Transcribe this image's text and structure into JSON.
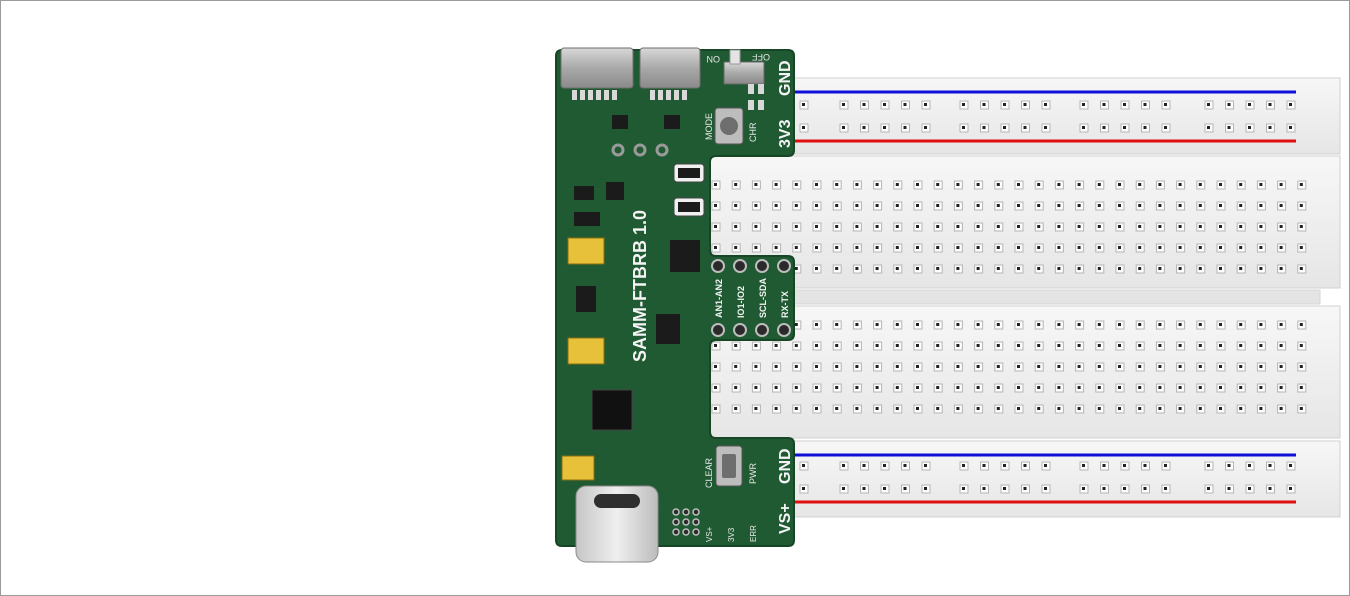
{
  "board": {
    "title": "SAMM-FTBRB 1.0",
    "top_rail_labels": {
      "gnd": "GND",
      "v3v3": "3V3"
    },
    "bottom_rail_labels": {
      "gnd": "GND",
      "vs": "VS+"
    },
    "switch_labels": {
      "on": "ON",
      "off": "OFF"
    },
    "button_labels": {
      "mode": "MODE",
      "chr": "CHR",
      "clear": "CLEAR",
      "pwr": "PWR"
    },
    "pin_labels": [
      "AN1-AN2",
      "IO1-IO2",
      "SCL-SDA",
      "RX-TX"
    ],
    "bottom_pin_labels": [
      "VS+",
      "3V3",
      "ERR"
    ]
  },
  "colors": {
    "pcb": "#1f5a32",
    "pcb_edge": "#174626",
    "breadboard": "#f1f1f1",
    "rail_positive": "#e01010",
    "rail_negative": "#1010d8",
    "tantalum": "#e8c13a"
  }
}
